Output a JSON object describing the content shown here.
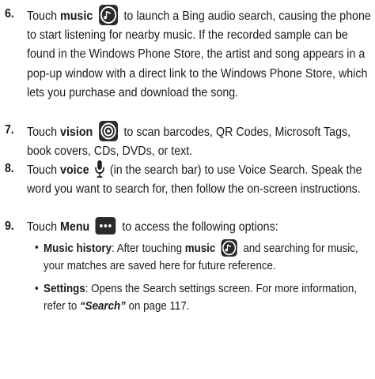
{
  "steps": [
    {
      "number": "6.",
      "pre": "Touch",
      "keyword": "music",
      "icon": "music-note-icon",
      "post": "to launch a Bing audio search, causing the phone to start listening for nearby music. If the recorded sample can be found in the Windows Phone Store, the artist and song appears in a pop-up window with a direct link to the Windows Phone Store, which lets you purchase and download the song."
    },
    {
      "number": "7.",
      "pre": "Touch",
      "keyword": "vision",
      "icon": "eye-icon",
      "post": "to scan barcodes, QR Codes, Microsoft Tags, book covers, CDs, DVDs, or text."
    },
    {
      "number": "8.",
      "pre": "Touch",
      "keyword": "voice",
      "icon": "microphone-icon",
      "post": "(in the search bar) to use Voice Search. Speak the word you want to search for, then follow the on-screen instructions."
    },
    {
      "number": "9.",
      "pre": "Touch",
      "keyword": "Menu",
      "icon": "more-dots-icon",
      "post": "to access the following options:"
    }
  ],
  "options": [
    {
      "label": "Music history",
      "text1": ": After touching",
      "keyword": "music",
      "icon": "music-note-icon",
      "text2": "and searching for music, your matches are saved here for future reference."
    },
    {
      "label": "Settings",
      "text1": ": Opens the Search settings screen. For more information, refer to",
      "ref": "“Search”",
      "text2": "on page 117."
    }
  ]
}
